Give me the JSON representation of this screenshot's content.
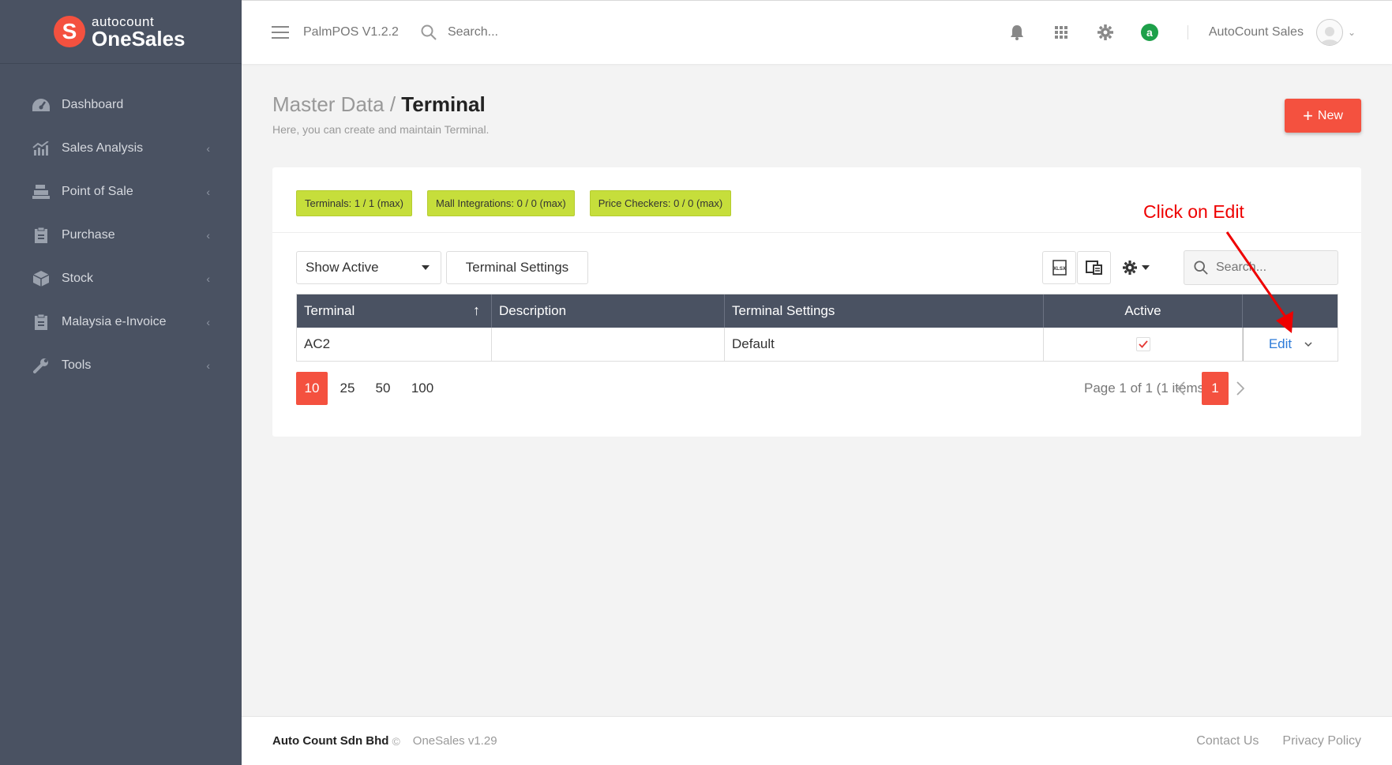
{
  "brand": {
    "logo_letter": "S",
    "logo_top": "autocount",
    "logo_name": "OneSales"
  },
  "sidebar": {
    "items": [
      {
        "label": "Dashboard",
        "icon": "dashboard-icon"
      },
      {
        "label": "Sales Analysis",
        "icon": "chart-icon"
      },
      {
        "label": "Point of Sale",
        "icon": "cash-register-icon"
      },
      {
        "label": "Purchase",
        "icon": "clipboard-icon"
      },
      {
        "label": "Stock",
        "icon": "box-icon"
      },
      {
        "label": "Malaysia e-Invoice",
        "icon": "invoice-icon"
      },
      {
        "label": "Tools",
        "icon": "wrench-icon"
      }
    ],
    "chevron": "‹"
  },
  "header": {
    "app_name": "PalmPOS V1.2.2",
    "search_placeholder": "Search...",
    "avatar_badge": "a",
    "user_name": "AutoCount Sales"
  },
  "page": {
    "breadcrumb_parent": "Master Data /",
    "breadcrumb_current": "Terminal",
    "subtitle": "Here, you can create and maintain Terminal.",
    "new_button": "New"
  },
  "badges": [
    "Terminals: 1 / 1 (max)",
    "Mall Integrations: 0 / 0 (max)",
    "Price Checkers: 0 / 0 (max)"
  ],
  "toolbar": {
    "filter_value": "Show Active",
    "terminal_settings_button": "Terminal Settings",
    "search_placeholder": "Search..."
  },
  "table": {
    "columns": [
      "Terminal",
      "Description",
      "Terminal Settings",
      "Active",
      ""
    ],
    "sort_indicator": "↑",
    "rows": [
      {
        "terminal": "AC2",
        "description": "",
        "settings": "Default",
        "active": true,
        "action": "Edit"
      }
    ]
  },
  "pager": {
    "sizes": [
      "10",
      "25",
      "50",
      "100"
    ],
    "active_size": "10",
    "info": "Page 1 of 1 (1 items)",
    "current_page": "1"
  },
  "annotation": {
    "text": "Click on Edit",
    "color": "#e00000"
  },
  "footer": {
    "company": "Auto Count Sdn Bhd",
    "copyright": "©",
    "version": "OneSales v1.29",
    "links": [
      "Contact Us",
      "Privacy Policy"
    ]
  },
  "colors": {
    "accent": "#f4513f",
    "sidebar": "#4a5262",
    "badge": "#c6de3b",
    "link": "#2d7bd8"
  }
}
